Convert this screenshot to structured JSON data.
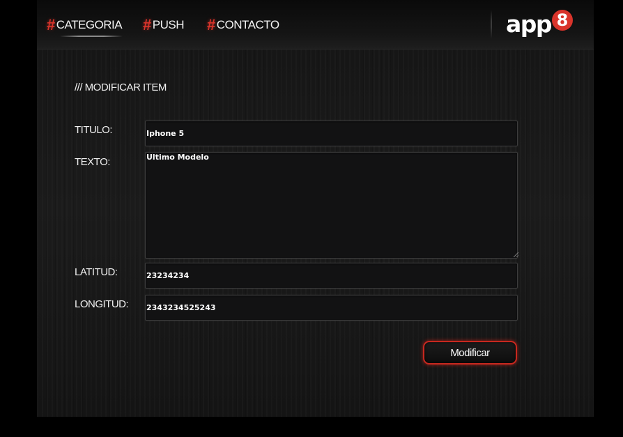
{
  "nav": {
    "items": [
      {
        "hash": "#",
        "label": "CATEGORIA"
      },
      {
        "hash": "#",
        "label": "PUSH"
      },
      {
        "hash": "#",
        "label": "CONTACTO"
      }
    ]
  },
  "logo": {
    "text": "app",
    "badge": "8"
  },
  "form": {
    "title": "/// MODIFICAR ITEM",
    "titulo_label": "TITULO:",
    "titulo_value": "Iphone 5",
    "texto_label": "TEXTO:",
    "texto_value": "Ultimo Modelo",
    "latitud_label": "LATITUD:",
    "latitud_value": "23234234",
    "longitud_label": "LONGITUD:",
    "longitud_value": "2343234525243",
    "submit_label": "Modificar"
  },
  "colors": {
    "accent": "#d9342b",
    "background": "#1b1b1b",
    "field_background": "#121213"
  }
}
